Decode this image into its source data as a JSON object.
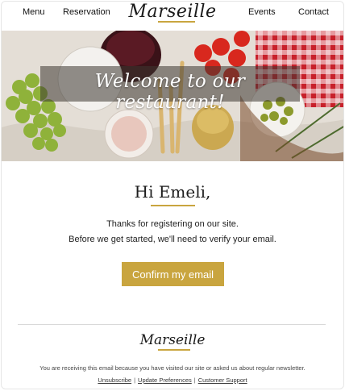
{
  "nav": {
    "menu": "Menu",
    "reservation": "Reservation",
    "brand": "Marseille",
    "events": "Events",
    "contact": "Contact"
  },
  "hero": {
    "title": "Welcome to our restaurant!"
  },
  "body": {
    "greeting": "Hi Emeli,",
    "line1": "Thanks for registering on our site.",
    "line2": "Before we get started, we'll need to verify your email.",
    "cta_label": "Confirm my email"
  },
  "footer": {
    "brand": "Marseille",
    "note": "You are receiving this email because you have visited our site or asked us about regular newsletter.",
    "links": {
      "unsubscribe": "Unsubscribe",
      "preferences": "Update Preferences",
      "support": "Customer Support",
      "separator": "|"
    }
  },
  "colors": {
    "accent": "#c9a53f",
    "text": "#222222"
  }
}
